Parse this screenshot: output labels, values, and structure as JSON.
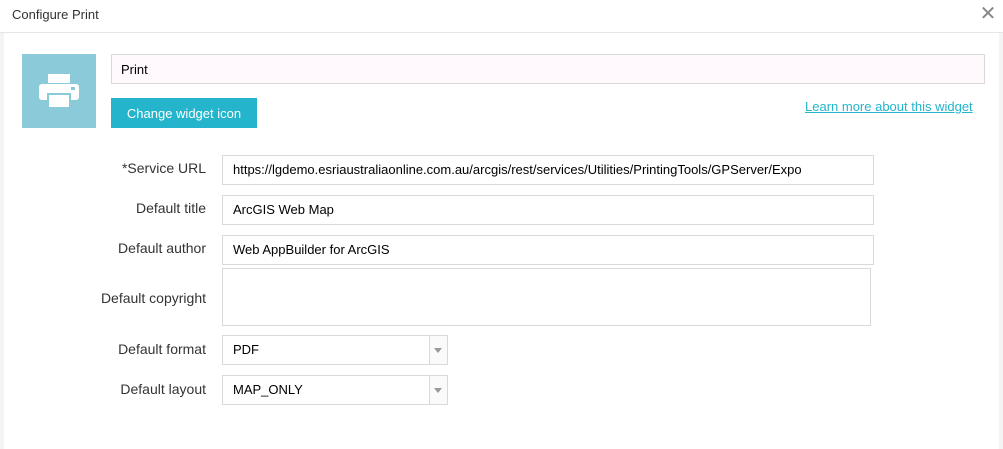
{
  "dialog": {
    "title": "Configure Print",
    "close_glyph": "✕"
  },
  "widget": {
    "icon": "printer-icon",
    "icon_bg": "#8bcad9",
    "name": "Print",
    "change_icon_label": "Change widget icon",
    "learn_more": "Learn more about this widget"
  },
  "form": {
    "service_url_label": "*Service URL",
    "service_url_value": "https://lgdemo.esriaustraliaonline.com.au/arcgis/rest/services/Utilities/PrintingTools/GPServer/Expo",
    "title_label": "Default title",
    "title_value": "ArcGIS Web Map",
    "author_label": "Default author",
    "author_value": "Web AppBuilder for ArcGIS",
    "copyright_label": "Default copyright",
    "copyright_value": "",
    "format_label": "Default format",
    "format_value": "PDF",
    "layout_label": "Default layout",
    "layout_value": "MAP_ONLY"
  },
  "colors": {
    "accent": "#24b5cc"
  }
}
